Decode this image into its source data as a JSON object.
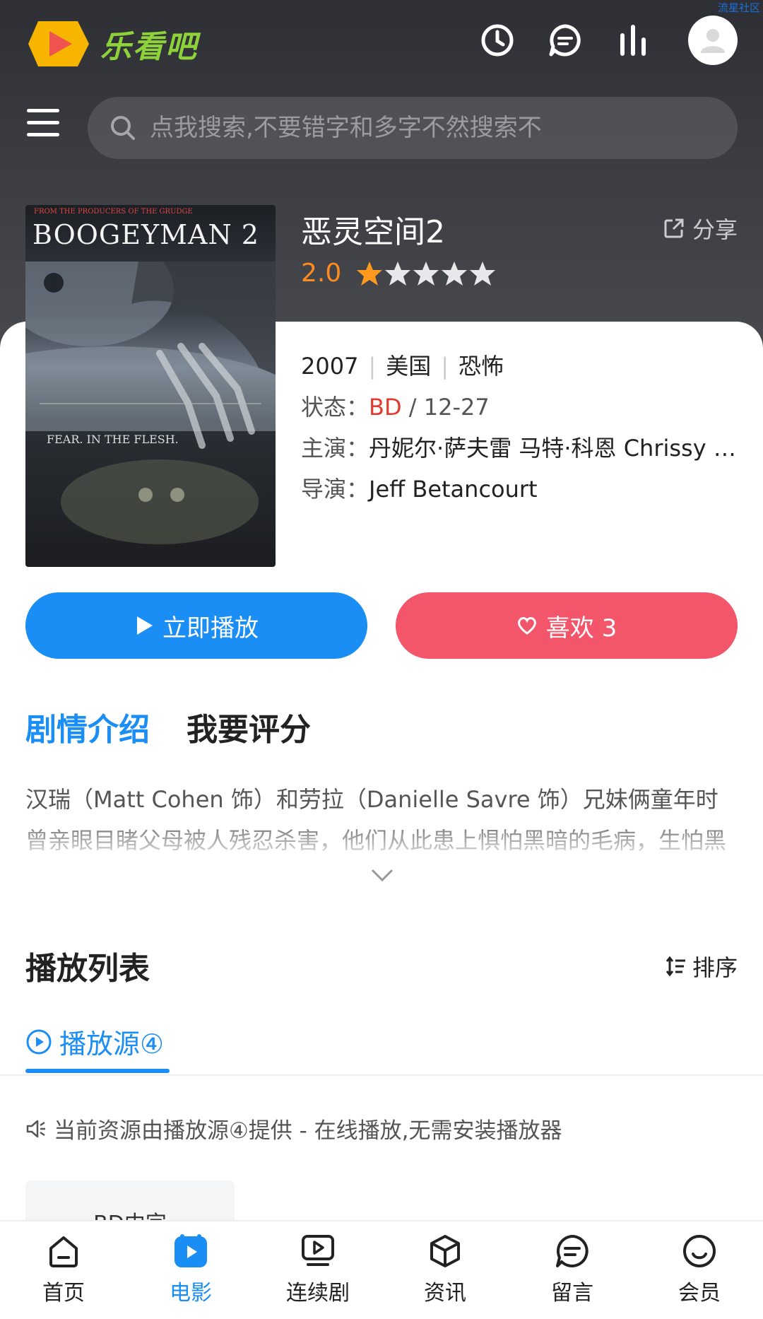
{
  "watermark": "流星社区",
  "app": {
    "name": "乐看吧"
  },
  "search": {
    "placeholder": "点我搜索,不要错字和多字不然搜索不"
  },
  "movie": {
    "title": "恶灵空间2",
    "share_label": "分享",
    "score": "2.0",
    "stars": 1,
    "year": "2007",
    "region": "美国",
    "genre": "恐怖",
    "status_label": "状态：",
    "status_quality": "BD",
    "status_date": "/ 12-27",
    "actors_label": "主演：",
    "actors": "丹妮尔·萨夫雷 马特·科恩 Chrissy G...",
    "director_label": "导演：",
    "director": "Jeff Betancourt",
    "poster": {
      "top_text": "FROM THE PRODUCERS OF THE GRUDGE",
      "title": "BOOGEYMAN 2",
      "tagline": "FEAR. IN THE FLESH."
    }
  },
  "actions": {
    "play_label": "立即播放",
    "like_label": "喜欢 3"
  },
  "tabs": [
    {
      "label": "剧情介绍",
      "active": true
    },
    {
      "label": "我要评分",
      "active": false
    }
  ],
  "description": "汉瑞（Matt Cohen 饰）和劳拉（Danielle Savre 饰）兄妹俩童年时曾亲眼目睹父母被人残忍杀害，他们从此患上惧怕黑暗的毛病，生怕黑",
  "playlist": {
    "title": "播放列表",
    "sort_label": "排序",
    "source_label": "播放源④",
    "notice": "当前资源由播放源④提供 - 在线播放,无需安装播放器",
    "episodes": [
      "BD中字"
    ]
  },
  "nav": [
    {
      "label": "首页",
      "icon": "home-icon",
      "active": false
    },
    {
      "label": "电影",
      "icon": "movie-icon",
      "active": true
    },
    {
      "label": "连续剧",
      "icon": "tv-series-icon",
      "active": false
    },
    {
      "label": "资讯",
      "icon": "news-icon",
      "active": false
    },
    {
      "label": "留言",
      "icon": "message-icon",
      "active": false
    },
    {
      "label": "会员",
      "icon": "member-icon",
      "active": false
    }
  ],
  "colors": {
    "accent": "#1b8ef5",
    "like": "#f3556b",
    "score": "#ff8a1e",
    "status_red": "#e23a2e"
  }
}
